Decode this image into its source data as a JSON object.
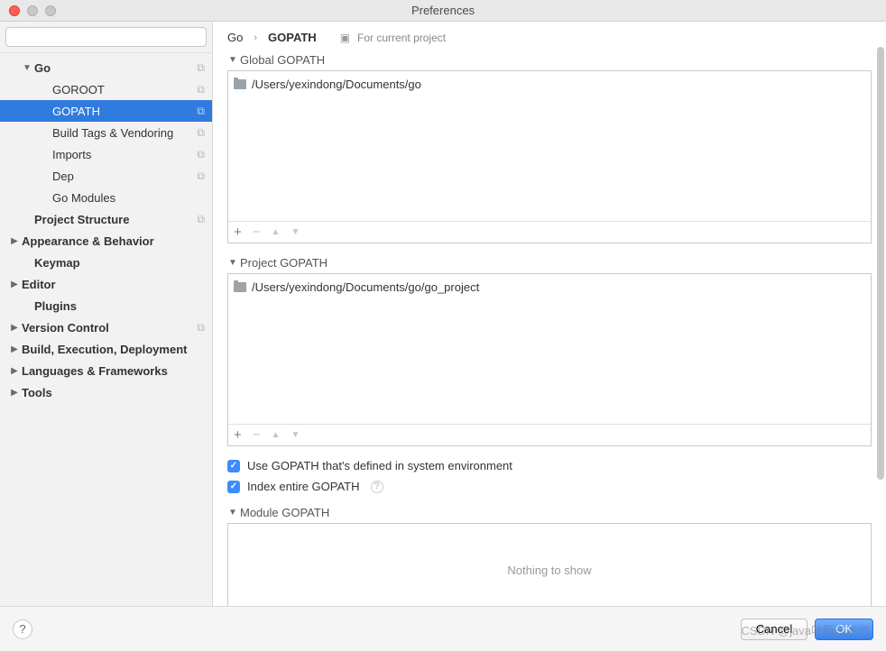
{
  "window": {
    "title": "Preferences"
  },
  "search": {
    "placeholder": ""
  },
  "sidebar": {
    "items": [
      {
        "label": "Go",
        "bold": true,
        "indent": 1,
        "disclosure": "down",
        "copy": true
      },
      {
        "label": "GOROOT",
        "indent": 2,
        "copy": true
      },
      {
        "label": "GOPATH",
        "indent": 2,
        "copy": true,
        "selected": true
      },
      {
        "label": "Build Tags & Vendoring",
        "indent": 2,
        "copy": true
      },
      {
        "label": "Imports",
        "indent": 2,
        "copy": true
      },
      {
        "label": "Dep",
        "indent": 2,
        "copy": true
      },
      {
        "label": "Go Modules",
        "indent": 2
      },
      {
        "label": "Project Structure",
        "bold": true,
        "indent": 1,
        "copy": true
      },
      {
        "label": "Appearance & Behavior",
        "bold": true,
        "indent": 0,
        "disclosure": "right"
      },
      {
        "label": "Keymap",
        "bold": true,
        "indent": 1
      },
      {
        "label": "Editor",
        "bold": true,
        "indent": 0,
        "disclosure": "right"
      },
      {
        "label": "Plugins",
        "bold": true,
        "indent": 1
      },
      {
        "label": "Version Control",
        "bold": true,
        "indent": 0,
        "disclosure": "right",
        "copy": true
      },
      {
        "label": "Build, Execution, Deployment",
        "bold": true,
        "indent": 0,
        "disclosure": "right"
      },
      {
        "label": "Languages & Frameworks",
        "bold": true,
        "indent": 0,
        "disclosure": "right"
      },
      {
        "label": "Tools",
        "bold": true,
        "indent": 0,
        "disclosure": "right"
      }
    ]
  },
  "breadcrumb": {
    "parent": "Go",
    "current": "GOPATH",
    "scope": "For current project"
  },
  "sections": {
    "global": {
      "title": "Global GOPATH",
      "paths": [
        "/Users/yexindong/Documents/go"
      ]
    },
    "project": {
      "title": "Project GOPATH",
      "paths": [
        "/Users/yexindong/Documents/go/go_project"
      ]
    },
    "module": {
      "title": "Module GOPATH",
      "empty": "Nothing to show"
    }
  },
  "checks": {
    "use_system": "Use GOPATH that's defined in system environment",
    "index_entire": "Index entire GOPATH"
  },
  "footer": {
    "cancel": "Cancel",
    "ok": "OK"
  },
  "watermark": "CSDN @java叶新东老师"
}
